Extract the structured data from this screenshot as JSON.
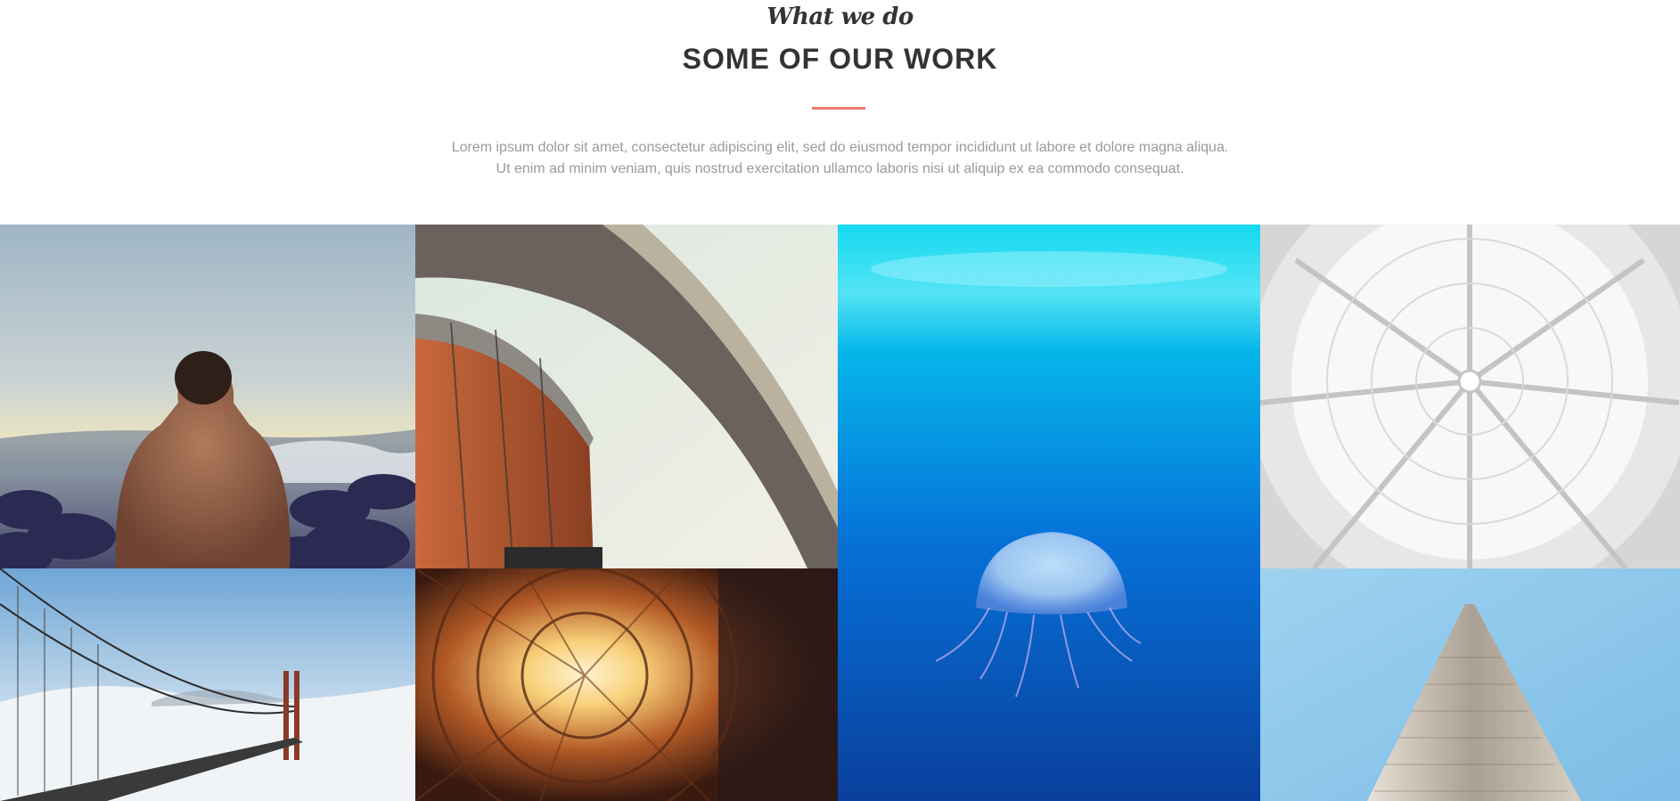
{
  "header": {
    "script_title": "What we do",
    "title": "SOME OF OUR WORK",
    "lead_line1": "Lorem ipsum dolor sit amet, consectetur adipiscing elit, sed do eiusmod tempor incididunt ut labore et dolore magna aliqua.",
    "lead_line2": "Ut enim ad minim veniam, quis nostrud exercitation ullamco laboris nisi ut aliquip ex ea commodo consequat."
  },
  "colors": {
    "accent": "#e87a6e",
    "heading": "#333333",
    "body_text": "#9a9a9a"
  },
  "gallery": {
    "items": [
      {
        "subject": "man-at-seashore-photo"
      },
      {
        "subject": "curved-building-photo"
      },
      {
        "subject": "jellyfish-photo"
      },
      {
        "subject": "glass-dome-ceiling-photo"
      },
      {
        "subject": "golden-gate-bridge-fog-photo"
      },
      {
        "subject": "courtyard-looking-up-photo"
      },
      {
        "subject": "skyscraper-photo"
      }
    ]
  }
}
